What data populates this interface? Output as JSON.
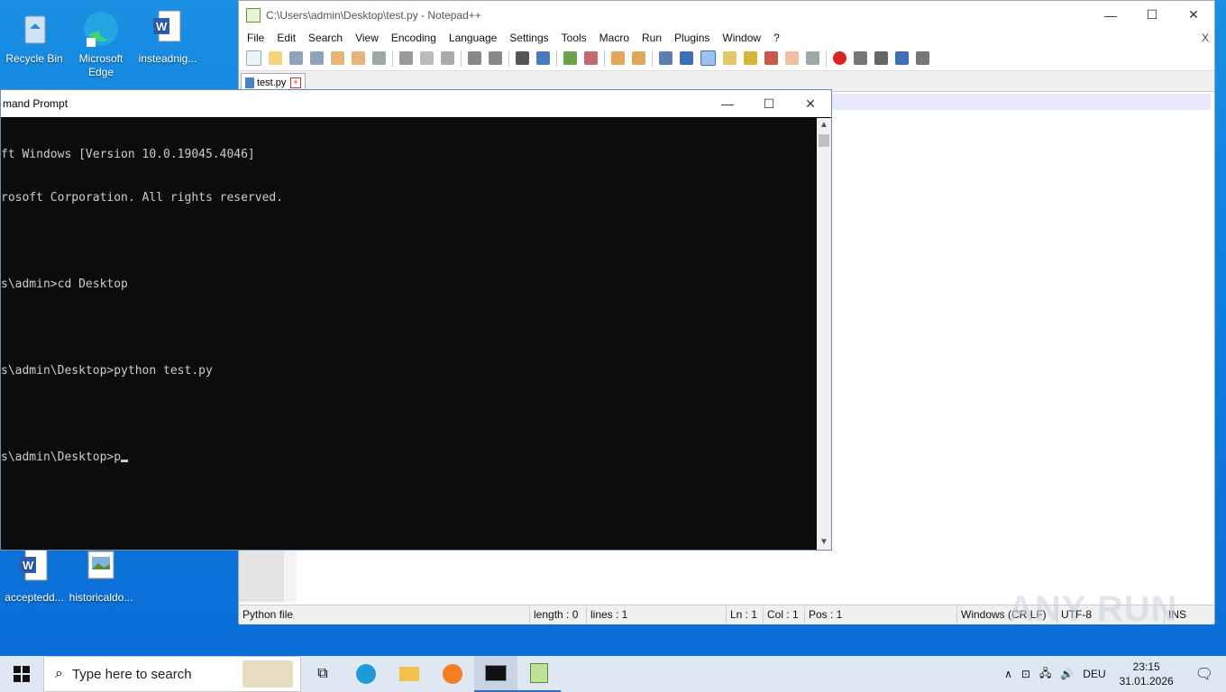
{
  "desktop": {
    "icons": [
      {
        "label": "Recycle Bin"
      },
      {
        "label": "Microsoft Edge"
      },
      {
        "label": "insteadnig..."
      },
      {
        "label": "acceptedd..."
      },
      {
        "label": "historicaldo..."
      }
    ]
  },
  "notepad": {
    "title": "C:\\Users\\admin\\Desktop\\test.py - Notepad++",
    "menu": [
      "File",
      "Edit",
      "Search",
      "View",
      "Encoding",
      "Language",
      "Settings",
      "Tools",
      "Macro",
      "Run",
      "Plugins",
      "Window",
      "?"
    ],
    "menu_close": "X",
    "tab": "test.py",
    "status": {
      "filetype": "Python file",
      "length": "length : 0",
      "lines": "lines : 1",
      "ln": "Ln : 1",
      "col": "Col : 1",
      "pos": "Pos : 1",
      "eol": "Windows (CR LF)",
      "encoding": "UTF-8",
      "mode": "INS"
    }
  },
  "cmd": {
    "title": "mand Prompt",
    "lines": [
      "ft Windows [Version 10.0.19045.4046]",
      "rosoft Corporation. All rights reserved.",
      "",
      "s\\admin>cd Desktop",
      "",
      "s\\admin\\Desktop>python test.py",
      "",
      "s\\admin\\Desktop>p"
    ]
  },
  "taskbar": {
    "search_placeholder": "Type here to search",
    "lang": "DEU",
    "time": "23:15",
    "date": "31.01.2026"
  },
  "watermark": "ANY RUN",
  "colors": {
    "desktop": "#0f7ee0",
    "console_bg": "#0c0c0c",
    "console_fg": "#cccccc"
  }
}
